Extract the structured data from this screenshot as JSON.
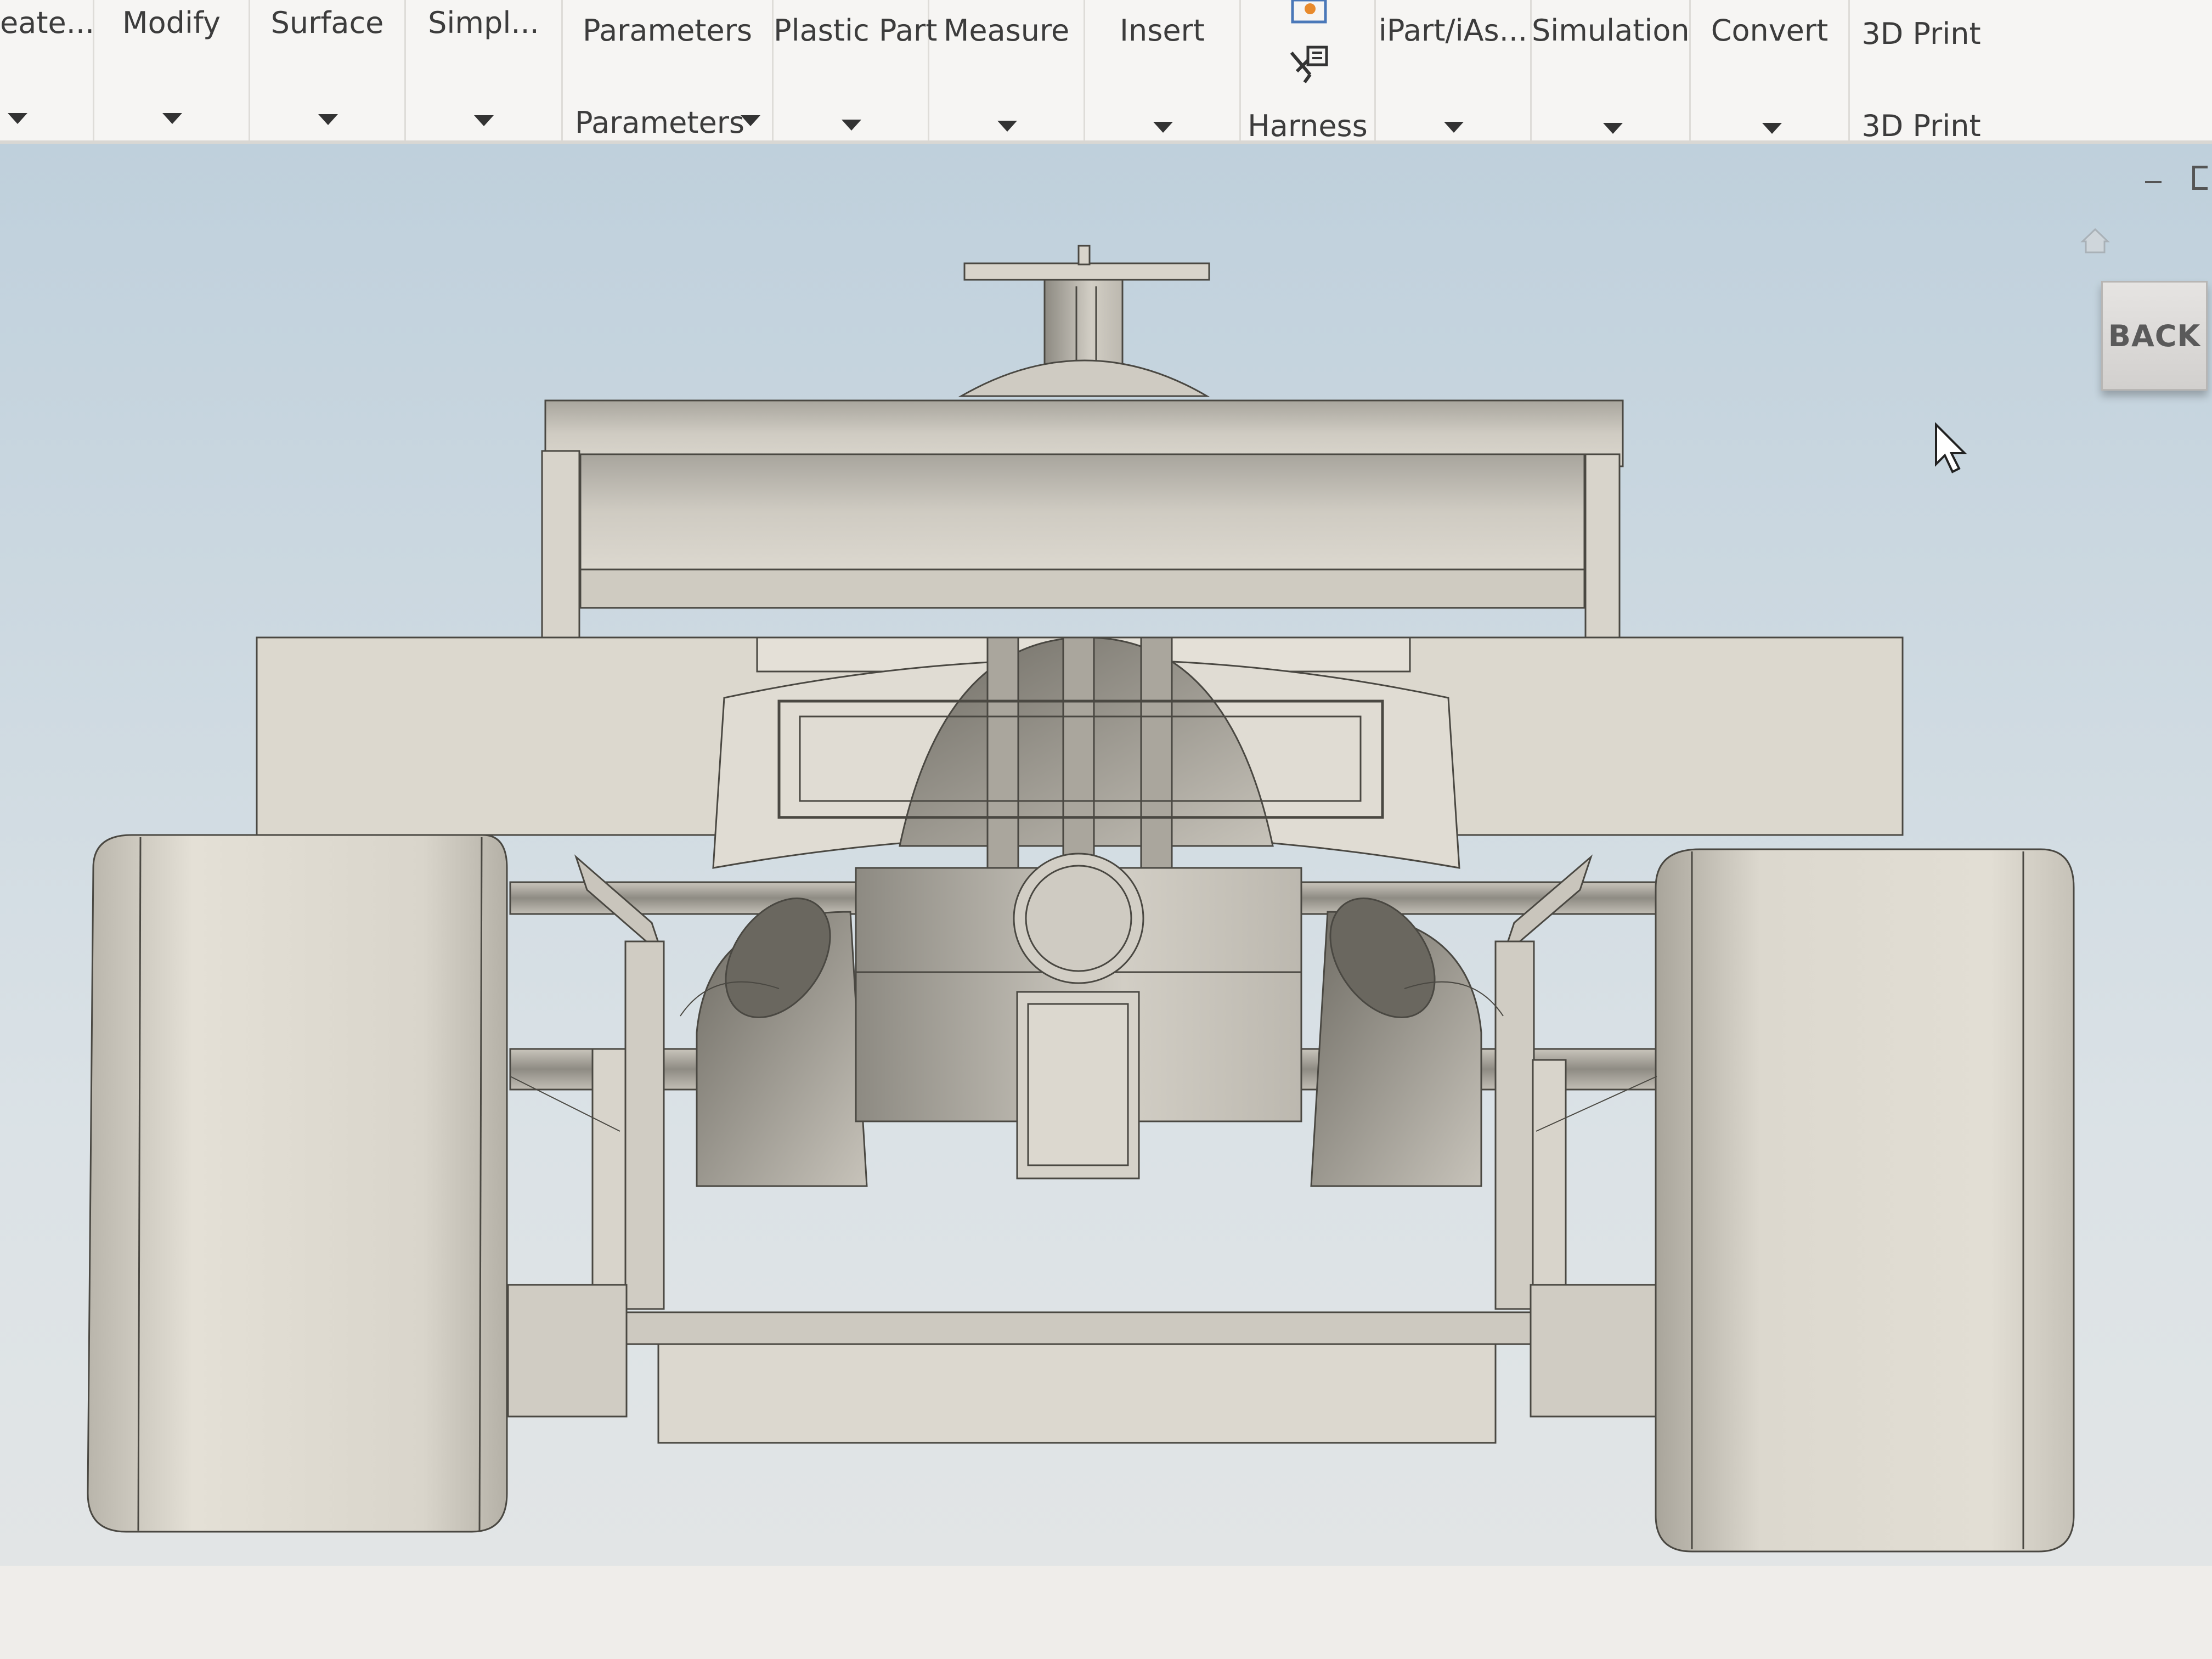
{
  "ribbon": {
    "panels": [
      {
        "label": "eate...",
        "sublabel": ""
      },
      {
        "label": "Modify",
        "sublabel": ""
      },
      {
        "label": "Surface",
        "sublabel": ""
      },
      {
        "label": "Simpl...",
        "sublabel": ""
      },
      {
        "label": "Parameters",
        "sublabel": "Parameters"
      },
      {
        "label": "Plastic Part",
        "sublabel": ""
      },
      {
        "label": "Measure",
        "sublabel": ""
      },
      {
        "label": "Insert",
        "sublabel": ""
      },
      {
        "label": "",
        "sublabel": "Harness"
      },
      {
        "label": "iPart/iAs...",
        "sublabel": ""
      },
      {
        "label": "Simulation",
        "sublabel": ""
      },
      {
        "label": "Convert",
        "sublabel": ""
      },
      {
        "label": "3D Print",
        "sublabel": "3D Print"
      }
    ]
  },
  "viewcube": {
    "back_label": "BACK"
  },
  "icons": {
    "home": "home-icon",
    "cursor": "mouse-pointer-icon",
    "minimize": "minimize-icon",
    "maximize": "maximize-icon",
    "harness": "harness-icon",
    "dropdown": "chevron-down-icon"
  },
  "colors": {
    "model": "#d8d4cb",
    "model_edge": "#4a4842",
    "viewport_top": "#bfd0dc",
    "viewport_bottom": "#e2e5e6",
    "ribbon": "#f6f5f3"
  }
}
